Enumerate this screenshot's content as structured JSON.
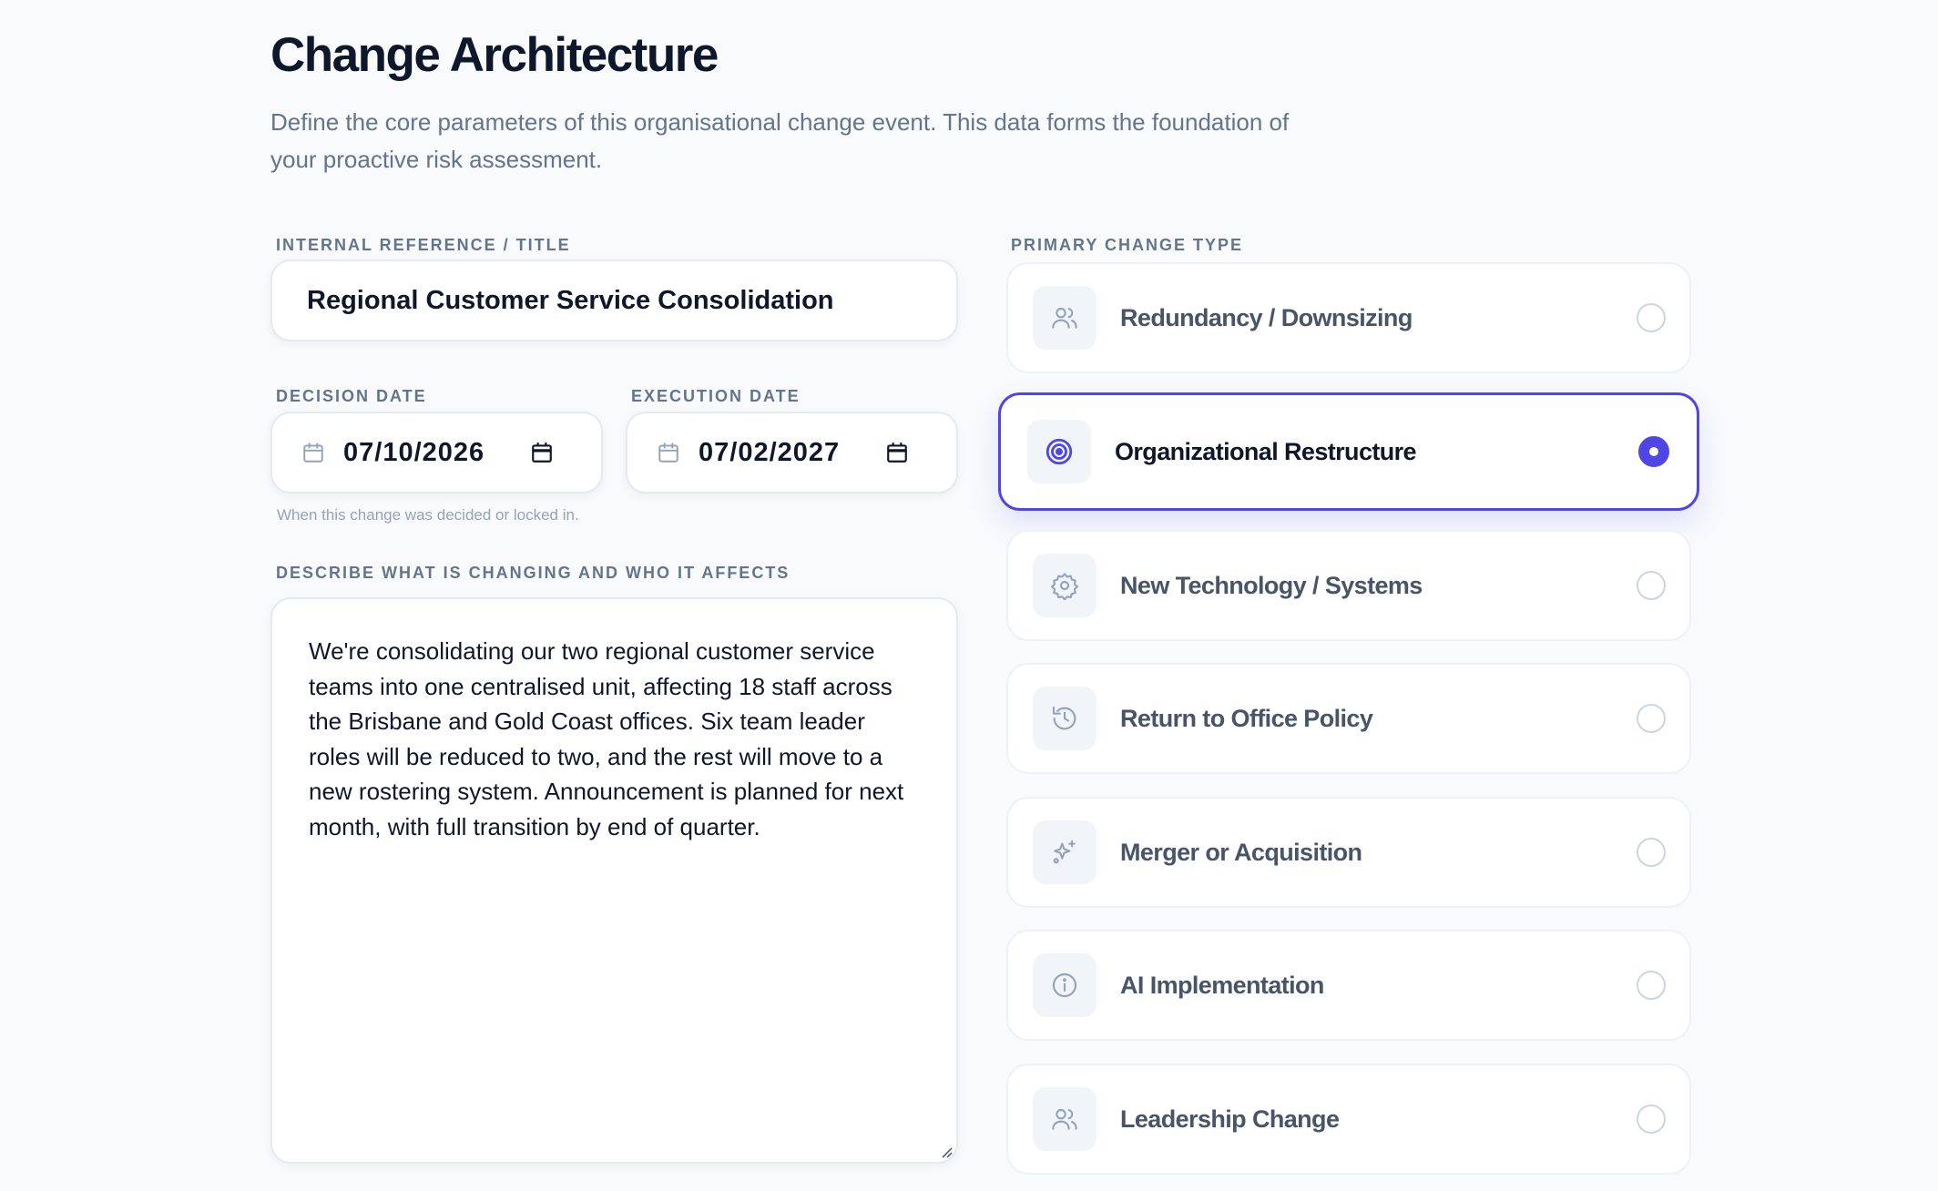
{
  "header": {
    "title": "Change Architecture",
    "subtitle": "Define the core parameters of this organisational change event. This data forms the foundation of your proactive risk assessment."
  },
  "form": {
    "title_label": "INTERNAL REFERENCE / TITLE",
    "title_value": "Regional Customer Service Consolidation",
    "decision_date_label": "DECISION DATE",
    "decision_date_value": "07/10/2026",
    "execution_date_label": "EXECUTION DATE",
    "execution_date_value": "07/02/2027",
    "decision_hint": "When this change was decided or locked in.",
    "description_label": "DESCRIBE WHAT IS CHANGING AND WHO IT AFFECTS",
    "description_value": "We're consolidating our two regional customer service teams into one centralised unit, affecting 18 staff across the Brisbane and Gold Coast offices. Six team leader roles will be reduced to two, and the rest will move to a new rostering system. Announcement is planned for next month, with full transition by end of quarter."
  },
  "change_type": {
    "label": "PRIMARY CHANGE TYPE",
    "selected": "Organizational Restructure",
    "options": [
      {
        "label": "Redundancy / Downsizing",
        "icon": "users-icon"
      },
      {
        "label": "Organizational Restructure",
        "icon": "target-icon"
      },
      {
        "label": "New Technology / Systems",
        "icon": "gear-icon"
      },
      {
        "label": "Return to Office Policy",
        "icon": "history-icon"
      },
      {
        "label": "Merger or Acquisition",
        "icon": "sparkles-icon"
      },
      {
        "label": "AI Implementation",
        "icon": "info-icon"
      },
      {
        "label": "Leadership Change",
        "icon": "users-icon"
      }
    ]
  },
  "colors": {
    "accent": "#4f46e5",
    "background": "#f8fafc",
    "muted_text": "#64748b"
  }
}
